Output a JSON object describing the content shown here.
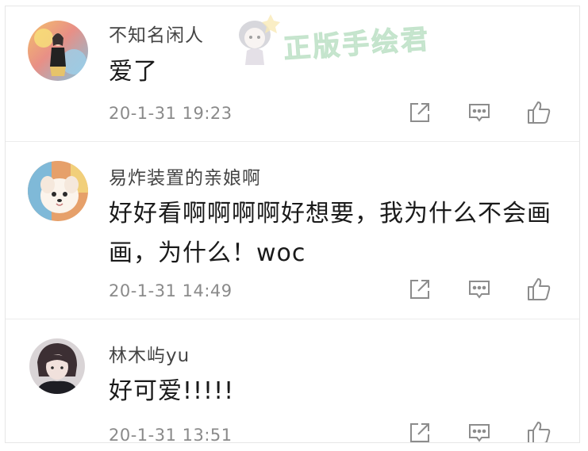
{
  "watermark": {
    "text": "正版手绘君"
  },
  "comments": [
    {
      "username": "不知名闲人",
      "text": "爱了",
      "time": "20-1-31 19:23"
    },
    {
      "username": "易炸装置的亲娘啊",
      "text": "好好看啊啊啊啊好想要，我为什么不会画画，为什么！woc",
      "time": "20-1-31 14:49"
    },
    {
      "username": "林木屿yu",
      "text": "好可爱!!!!!",
      "time": "20-1-31 13:51"
    }
  ],
  "icons": {
    "share": "share-icon",
    "reply": "comment-icon",
    "like": "thumbs-up-icon"
  },
  "colors": {
    "username": "#444444",
    "text": "#1a1a1a",
    "time": "#8a8a8a",
    "icon": "#8c8c8c",
    "watermark": "#cfe9d6"
  }
}
